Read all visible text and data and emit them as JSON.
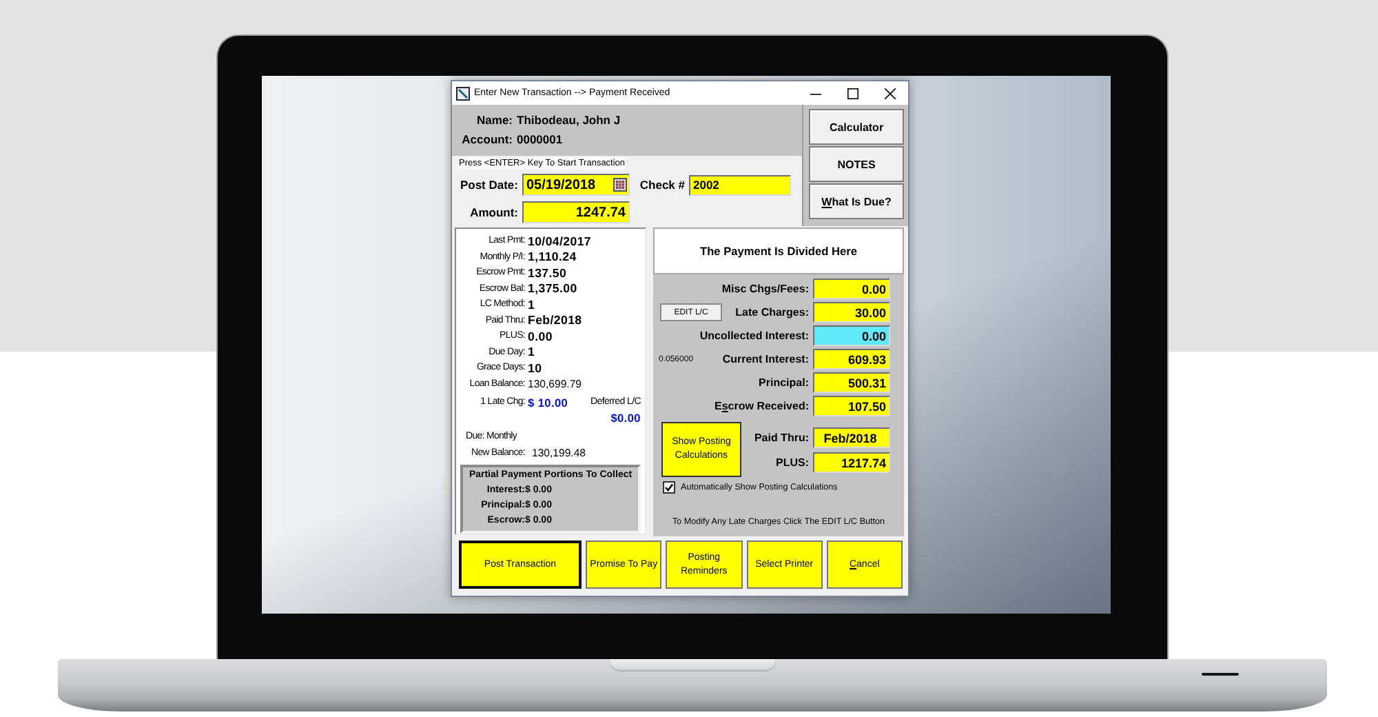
{
  "window": {
    "title": "Enter New Transaction --> Payment Received"
  },
  "header": {
    "name_label": "Name:",
    "name": "Thibodeau, John J",
    "account_label": "Account:",
    "account": "0000001"
  },
  "side_buttons": [
    {
      "parts": [
        {
          "text": "Calculator",
          "underline": false
        }
      ]
    },
    {
      "parts": [
        {
          "text": "NOTES",
          "underline": false
        }
      ]
    },
    {
      "parts": [
        {
          "text": "W",
          "underline": true
        },
        {
          "text": "hat Is Due?",
          "underline": false
        }
      ]
    }
  ],
  "entry": {
    "prompt": "Press <ENTER> Key To Start Transaction",
    "post_date": {
      "label": "Post Date:",
      "value": "05/19/2018"
    },
    "check": {
      "label": "Check #",
      "value": "2002"
    },
    "amount": {
      "label": "Amount:",
      "value": "1247.74"
    }
  },
  "loan_info": {
    "rows": [
      {
        "label": "Last Pmt:",
        "value": "10/04/2017",
        "kind": "bold"
      },
      {
        "label": "Monthly P/I:",
        "value": "1,110.24",
        "kind": "bold"
      },
      {
        "label": "Escrow Pmt:",
        "value": "137.50",
        "kind": "bold"
      },
      {
        "label": "Escrow Bal:",
        "value": "1,375.00",
        "kind": "bold"
      },
      {
        "label": "LC Method:",
        "value": "1",
        "kind": "bold"
      },
      {
        "label": "Paid Thru:",
        "value": "Feb/2018",
        "kind": "bold"
      },
      {
        "label": "PLUS:",
        "value": "0.00",
        "kind": "bold"
      },
      {
        "label": "Due Day:",
        "value": "1",
        "kind": "bold"
      },
      {
        "label": "Grace Days:",
        "value": "10",
        "kind": "bold"
      },
      {
        "label": "Loan Balance:",
        "value": "130,699.79",
        "kind": "plain"
      }
    ],
    "late_charge": {
      "label": "1 Late Chg:",
      "value": "$ 10.00",
      "deferred_label": "Deferred L/C",
      "deferred_value": "$0.00"
    },
    "due": "Due: Monthly",
    "new_balance": {
      "label": "New Balance:",
      "value": "130,199.48"
    },
    "partial": {
      "title": "Partial Payment Portions To Collect",
      "rows": [
        {
          "label": "Interest:",
          "value": "$ 0.00"
        },
        {
          "label": "Principal:",
          "value": "$ 0.00"
        },
        {
          "label": "Escrow:",
          "value": "$ 0.00"
        }
      ]
    }
  },
  "distribution": {
    "title": "The Payment Is Divided Here",
    "rows": [
      {
        "label_parts": [
          {
            "text": "Misc Chgs/Fees:",
            "underline": false
          }
        ],
        "value": "0.00",
        "color": "#ffff00"
      },
      {
        "button": "EDIT L/C",
        "label_parts": [
          {
            "text": "Late Charges:",
            "underline": false
          }
        ],
        "value": "30.00",
        "color": "#ffff00"
      },
      {
        "label_parts": [
          {
            "text": "Uncollected Interest:",
            "underline": false
          }
        ],
        "value": "0.00",
        "color": "#5ee8f8"
      },
      {
        "note": "0.056000",
        "label_parts": [
          {
            "text": "Current Interest:",
            "underline": false
          }
        ],
        "value": "609.93",
        "color": "#ffff00"
      },
      {
        "label_parts": [
          {
            "text": "Principal:",
            "underline": false
          }
        ],
        "value": "500.31",
        "color": "#ffff00"
      },
      {
        "label_parts": [
          {
            "text": "E",
            "underline": false
          },
          {
            "text": "s",
            "underline": true
          },
          {
            "text": "crow Received:",
            "underline": false
          }
        ],
        "value": "107.50",
        "color": "#ffff00"
      }
    ]
  },
  "posting": {
    "button": "Show Posting Calculations",
    "rows": [
      {
        "label": "Paid Thru:",
        "value": "Feb/2018"
      },
      {
        "label": "PLUS:",
        "value": "1217.74"
      }
    ]
  },
  "auto_show": {
    "label": "Automatically Show Posting Calculations",
    "checked": true
  },
  "hint": "To Modify Any Late Charges Click The EDIT L/C Button",
  "buttons": [
    {
      "parts": [
        {
          "text": "Post Transaction",
          "underline": false
        }
      ],
      "default": true
    },
    {
      "parts": [
        {
          "text": "Promise To Pay",
          "underline": false
        }
      ],
      "default": false
    },
    {
      "parts": [
        {
          "text": "Posting Reminders",
          "underline": false
        }
      ],
      "default": false
    },
    {
      "parts": [
        {
          "text": "Select Printer",
          "underline": false
        }
      ],
      "default": false
    },
    {
      "parts": [
        {
          "text": "C",
          "underline": true
        },
        {
          "text": "ancel",
          "underline": false
        }
      ],
      "default": false
    }
  ]
}
